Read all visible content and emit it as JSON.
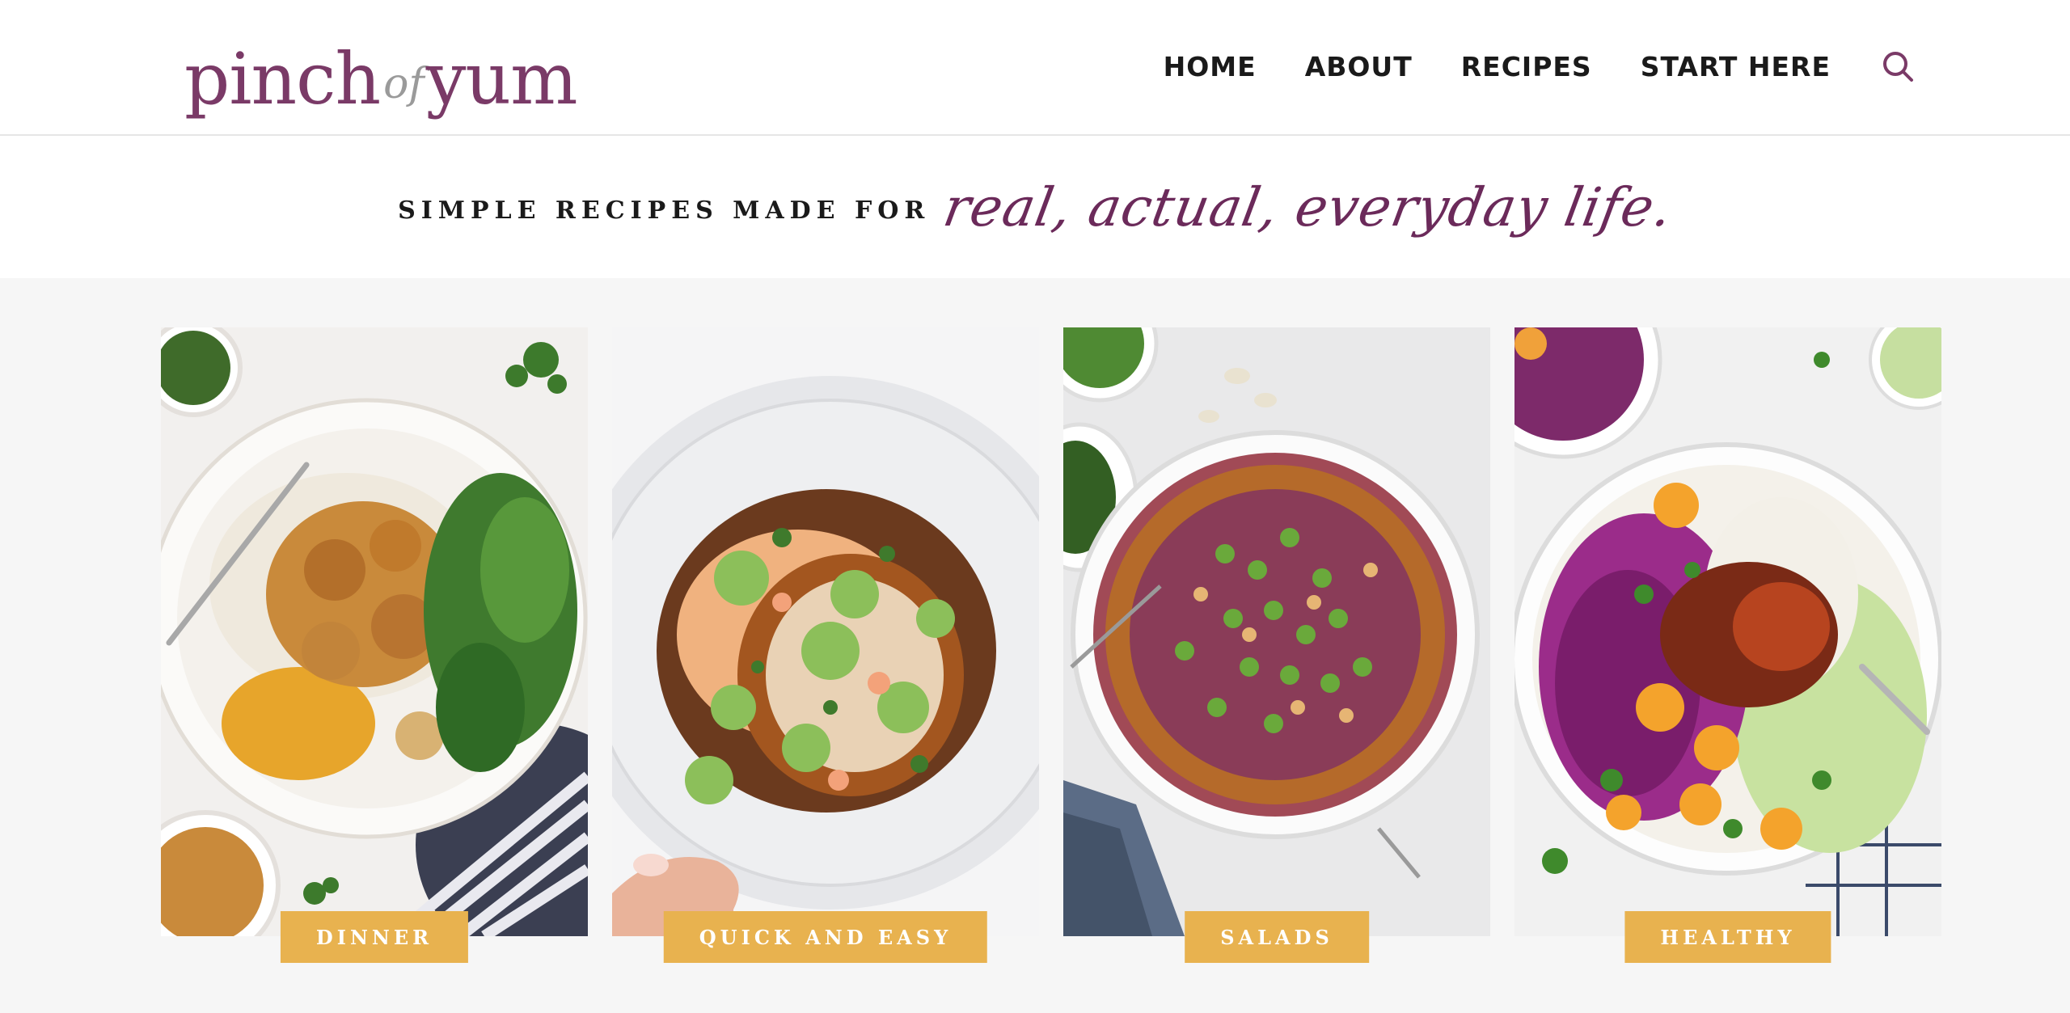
{
  "logo": {
    "part1": "pinch",
    "part2": "of",
    "part3": "yum"
  },
  "nav": {
    "home": "HOME",
    "about": "ABOUT",
    "recipes": "RECIPES",
    "start_here": "START HERE",
    "search_icon": "search-icon"
  },
  "tagline": {
    "plain": "SIMPLE RECIPES MADE FOR",
    "script": "real, actual, everyday life."
  },
  "cards": [
    {
      "label": "DINNER",
      "image": "curry-rice-plate"
    },
    {
      "label": "QUICK AND EASY",
      "image": "tostada-plate"
    },
    {
      "label": "SALADS",
      "image": "crunchy-salad-bowl"
    },
    {
      "label": "HEALTHY",
      "image": "salmon-cabbage-bowl"
    }
  ],
  "colors": {
    "brand": "#7a3a67",
    "script": "#6b2a5a",
    "label_bg": "#e8b24f",
    "page_bg": "#f6f6f6"
  }
}
